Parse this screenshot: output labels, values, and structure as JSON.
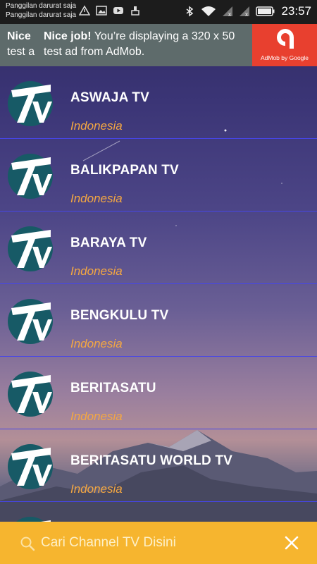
{
  "status_bar": {
    "notifications": [
      "Panggilan darurat saja",
      "Panggilan darurat saja"
    ],
    "time": "23:57"
  },
  "ad": {
    "peek_title": "Nice",
    "peek_line2": "test a",
    "title": "Nice job!",
    "message": "You’re displaying a 320 x 50 test ad from AdMob.",
    "brand": "AdMob by Google",
    "brand_color": "#e8402f"
  },
  "channels": [
    {
      "name": "ASWAJA TV",
      "country": "Indonesia"
    },
    {
      "name": "BALIKPAPAN TV",
      "country": "Indonesia"
    },
    {
      "name": "BARAYA TV",
      "country": "Indonesia"
    },
    {
      "name": "BENGKULU TV",
      "country": "Indonesia"
    },
    {
      "name": "BERITASATU",
      "country": "Indonesia"
    },
    {
      "name": "BERITASATU WORLD TV",
      "country": "Indonesia"
    }
  ],
  "search": {
    "placeholder": "Cari Channel TV Disini",
    "value": ""
  },
  "colors": {
    "accent": "#f6b52f",
    "country_text": "#f4a742",
    "divider": "#4646e8",
    "logo_circle": "#175a66"
  },
  "icons": [
    "search-icon",
    "close-icon",
    "tv-logo-icon",
    "admob-logo-icon",
    "wifi-icon",
    "bluetooth-icon",
    "battery-icon",
    "signal-icon"
  ]
}
